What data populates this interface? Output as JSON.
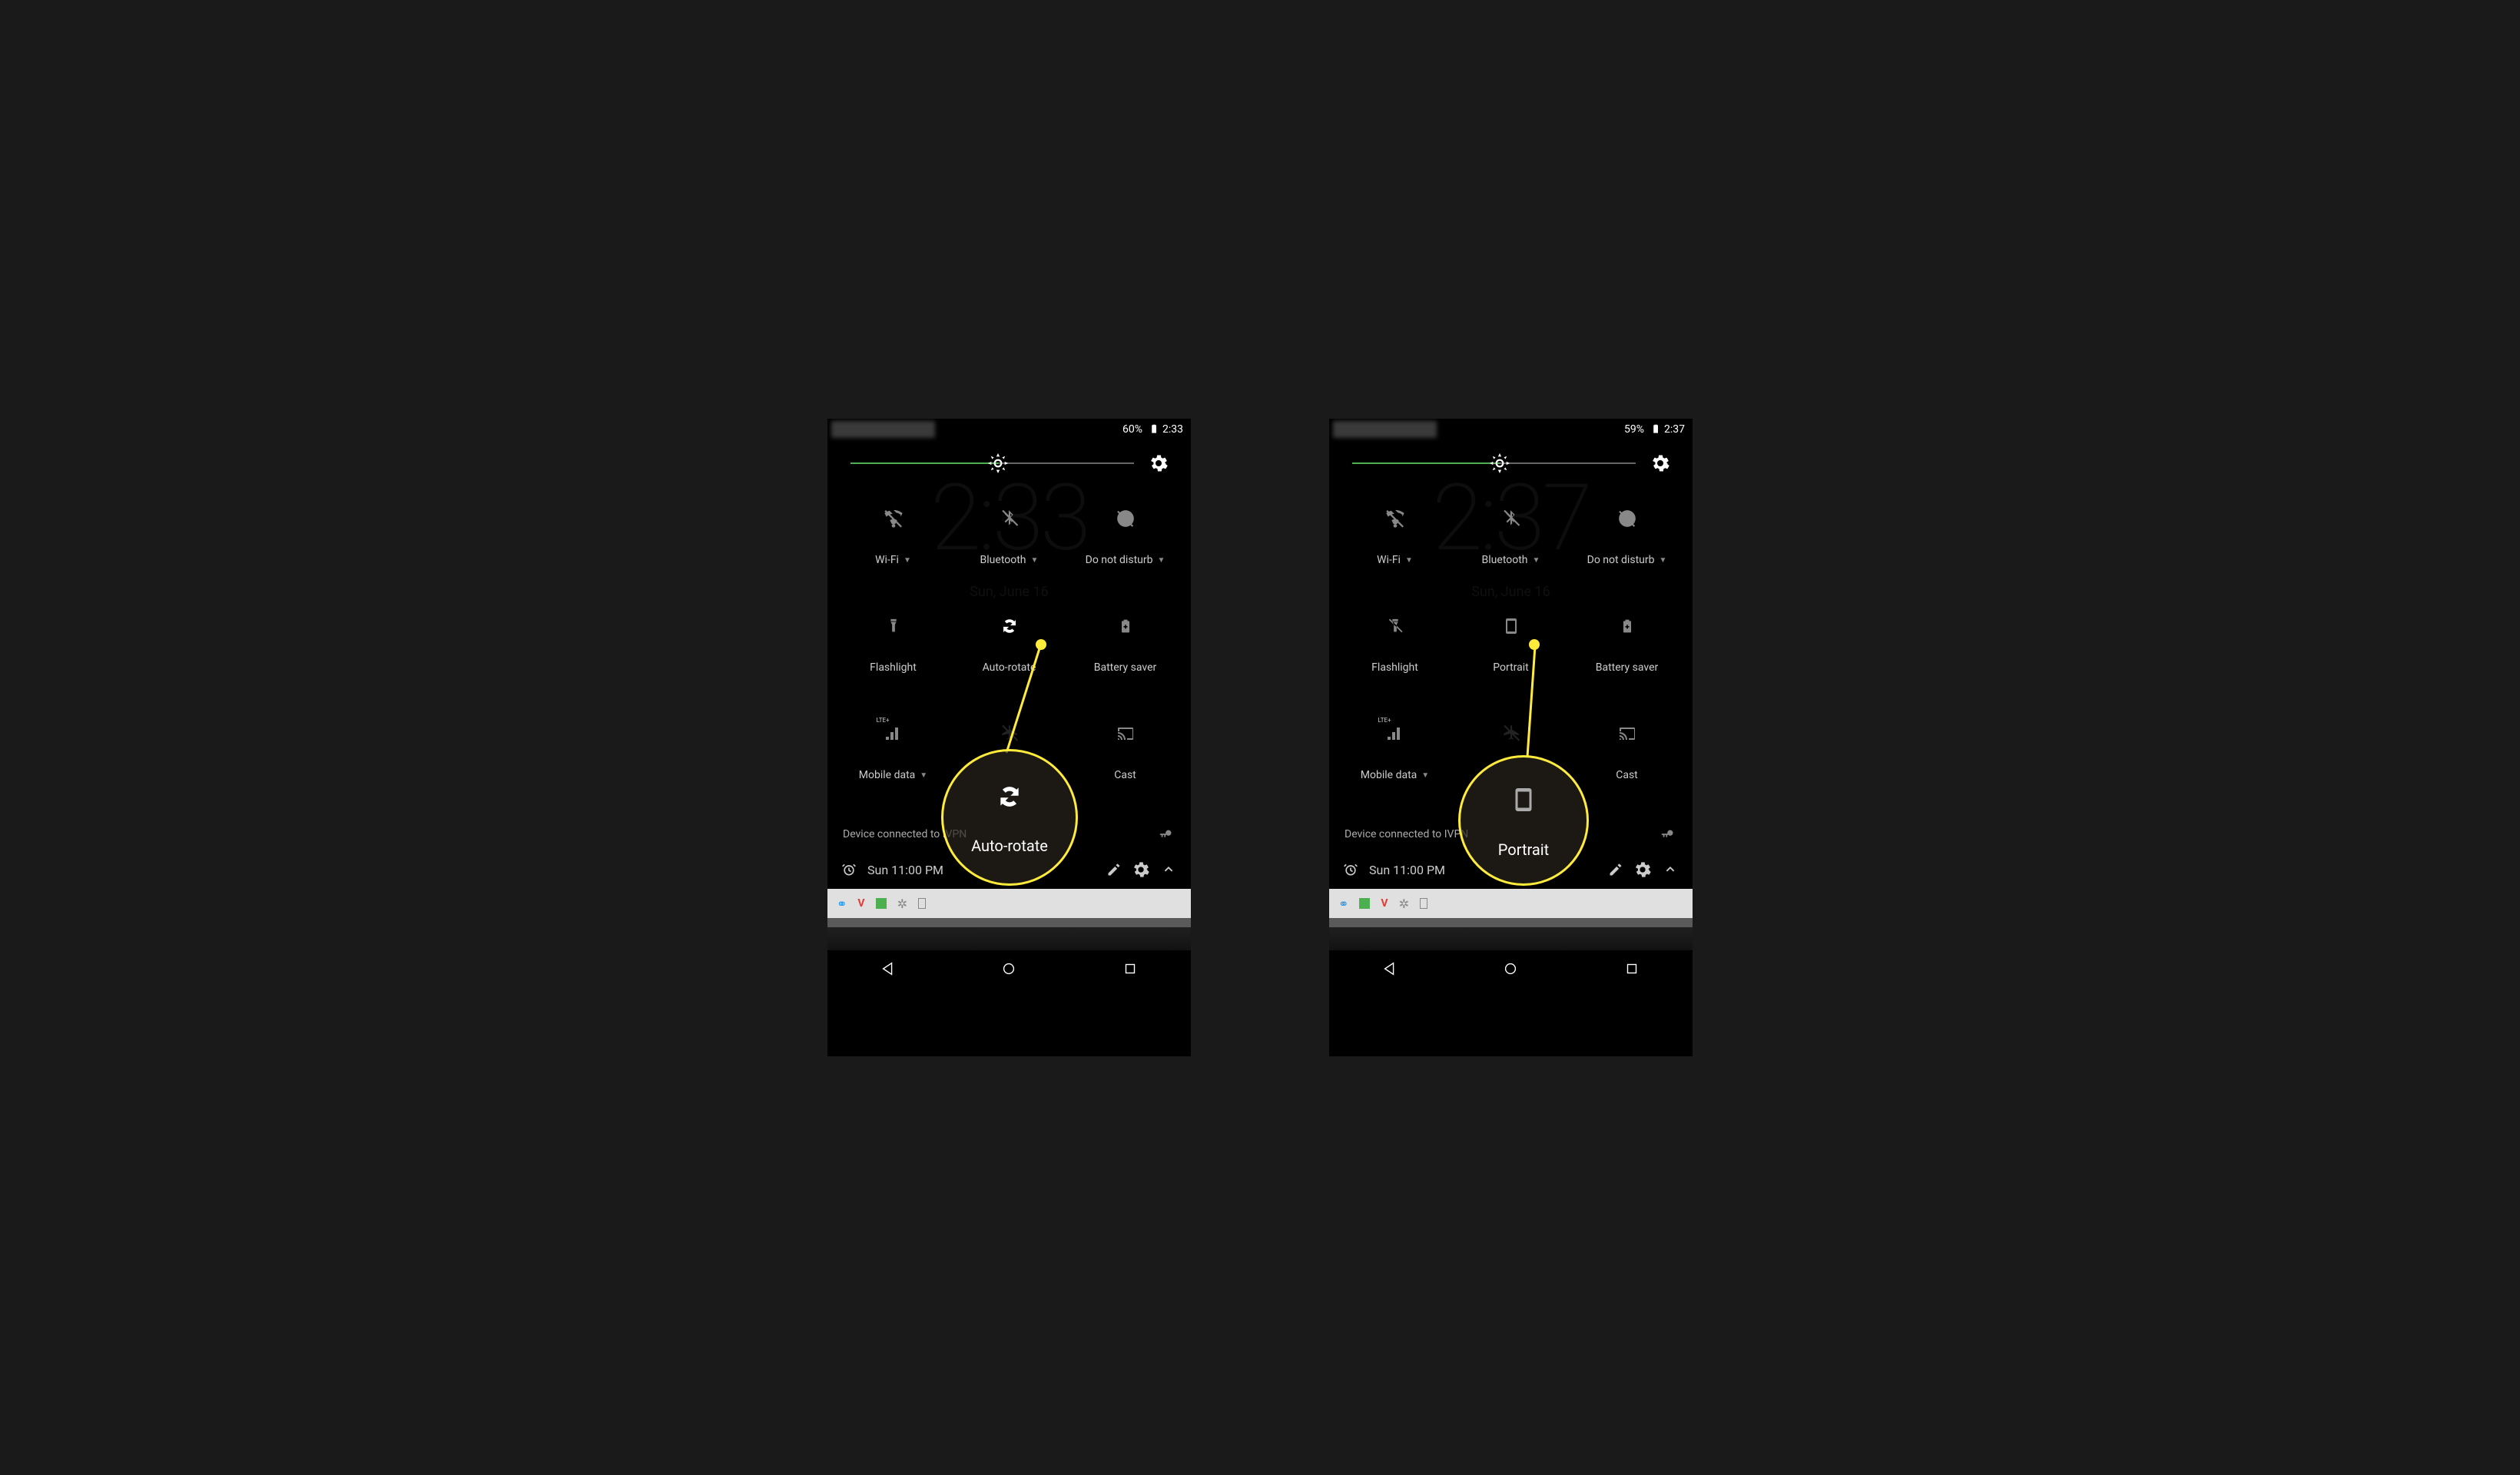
{
  "left": {
    "status": {
      "battery": "60%",
      "time": "2:33"
    },
    "bg_clock": "2:33",
    "bg_date": "Sun, June 16",
    "tiles": {
      "wifi": "Wi-Fi",
      "bluetooth": "Bluetooth",
      "dnd": "Do not disturb",
      "flashlight": "Flashlight",
      "rotate": "Auto-rotate",
      "battery_saver": "Battery saver",
      "mobile": "Mobile data",
      "cast": "Cast"
    },
    "vpn": "Device connected to IVPN",
    "alarm": "Sun 11:00 PM",
    "highlight_label": "Auto-rotate"
  },
  "right": {
    "status": {
      "battery": "59%",
      "time": "2:37"
    },
    "bg_clock": "2:37",
    "bg_date": "Sun, June 16",
    "tiles": {
      "wifi": "Wi-Fi",
      "bluetooth": "Bluetooth",
      "dnd": "Do not disturb",
      "flashlight": "Flashlight",
      "rotate": "Portrait",
      "battery_saver": "Battery saver",
      "mobile": "Mobile data",
      "cast": "Cast"
    },
    "vpn": "Device connected to IVPN",
    "alarm": "Sun 11:00 PM",
    "highlight_label": "Portrait"
  },
  "mobile_signal": "LTE+"
}
